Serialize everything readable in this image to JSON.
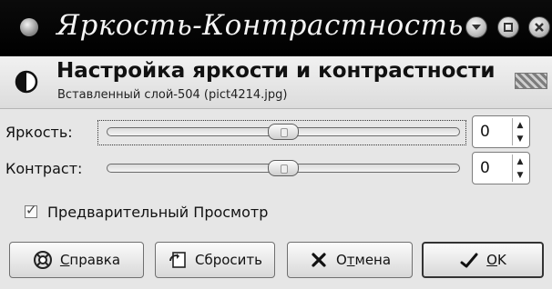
{
  "window": {
    "title": "Яркость-Контрастность"
  },
  "header": {
    "title": "Настройка яркости и контрастности",
    "subtitle": "Вставленный слой-504 (pict4214.jpg)"
  },
  "brightness": {
    "label": "Яркость:",
    "value": "0",
    "level": 0.5
  },
  "contrast": {
    "label": "Контраст:",
    "value": "0",
    "level": 0.5
  },
  "preview": {
    "label": "Предварительный Просмотр",
    "checked": true
  },
  "buttons": {
    "help_u": "С",
    "help_rest": "правка",
    "reset": "Сбросить",
    "cancel_pre": "О",
    "cancel_u": "т",
    "cancel_rest": "мена",
    "ok_u": "O",
    "ok_rest": "K"
  }
}
